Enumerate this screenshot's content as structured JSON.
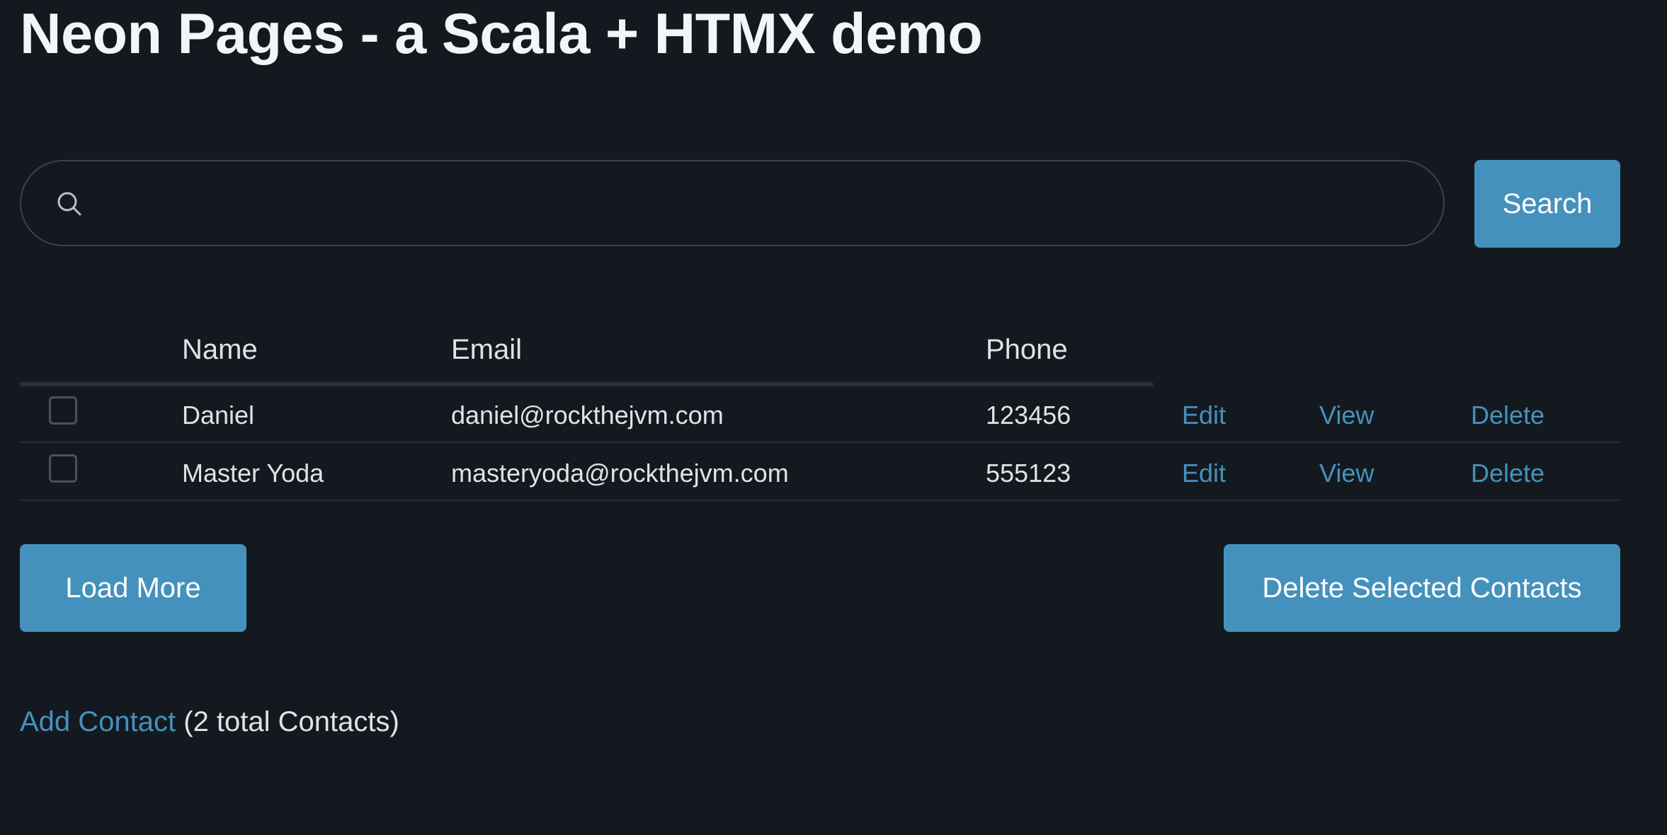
{
  "page": {
    "title": "Neon Pages - a Scala + HTMX demo"
  },
  "search": {
    "icon": "search-icon",
    "value": "",
    "placeholder": "",
    "button_label": "Search"
  },
  "table": {
    "columns": [
      "Name",
      "Email",
      "Phone"
    ],
    "rows": [
      {
        "checked": false,
        "name": "Daniel",
        "email": "daniel@rockthejvm.com",
        "phone": "123456",
        "edit_label": "Edit",
        "view_label": "View",
        "delete_label": "Delete"
      },
      {
        "checked": false,
        "name": "Master Yoda",
        "email": "masteryoda@rockthejvm.com",
        "phone": "555123",
        "edit_label": "Edit",
        "view_label": "View",
        "delete_label": "Delete"
      }
    ]
  },
  "actions": {
    "load_more_label": "Load More",
    "delete_selected_label": "Delete Selected Contacts"
  },
  "footer": {
    "add_contact_label": "Add Contact",
    "count_text": " (2 total Contacts)"
  },
  "colors": {
    "background": "#141920",
    "accent": "#4591bd",
    "text": "#dfe3e8"
  }
}
